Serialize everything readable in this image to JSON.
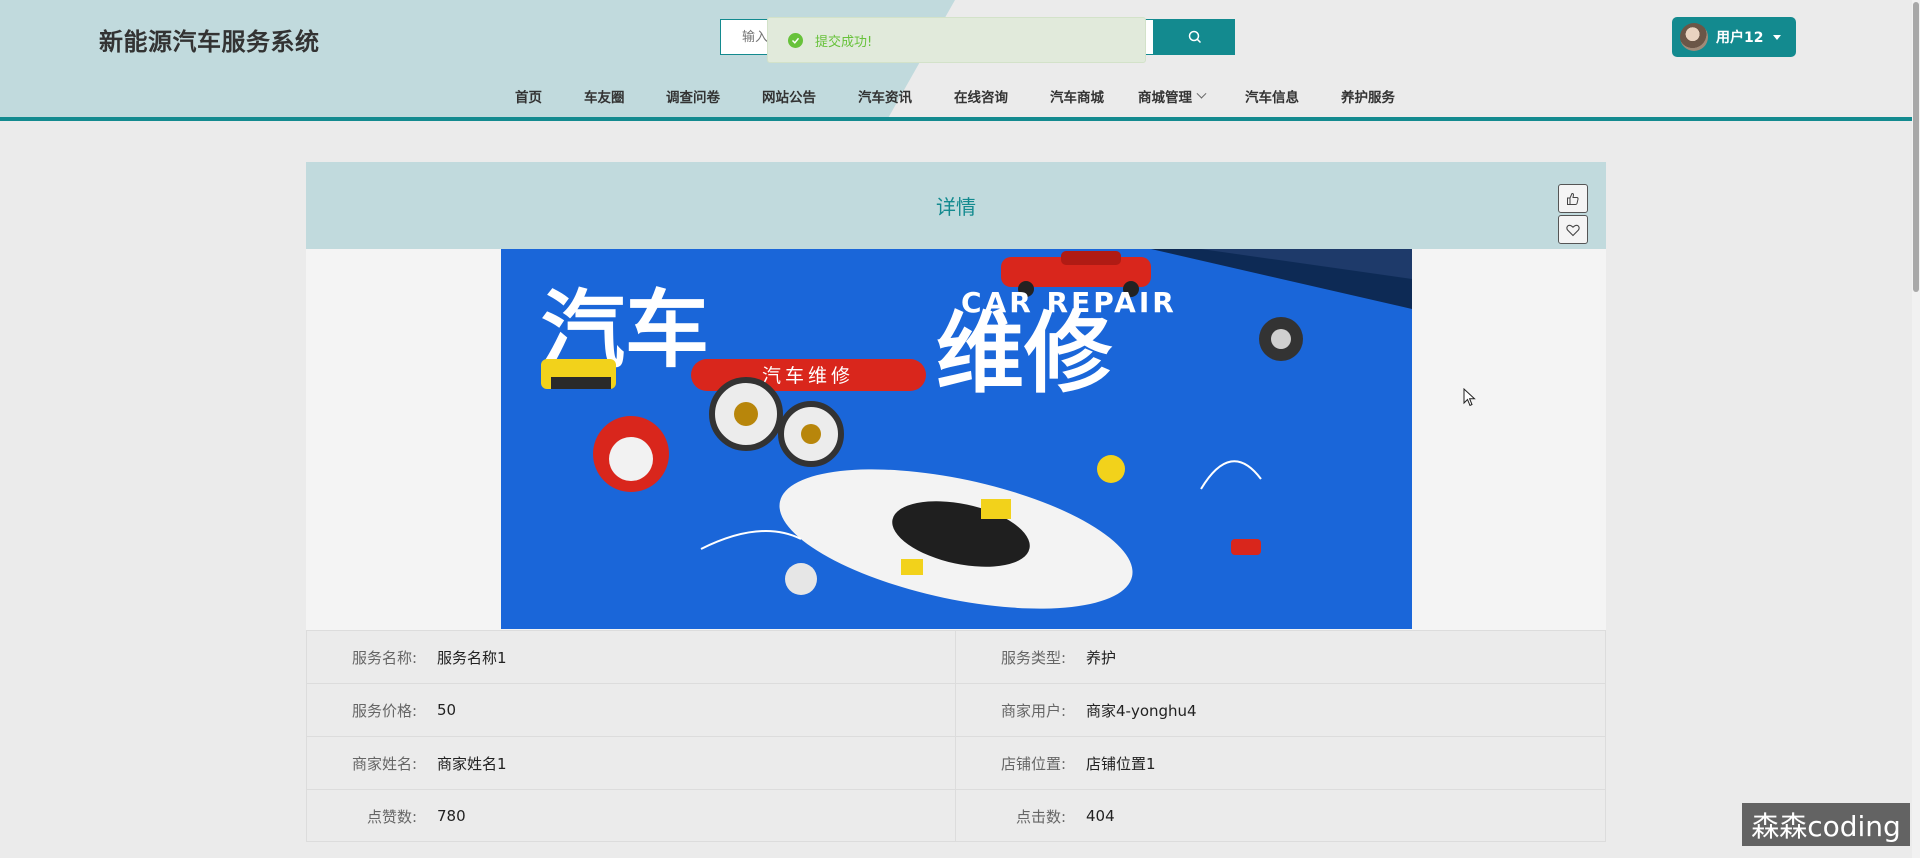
{
  "header": {
    "site_title": "新能源汽车服务系统",
    "search_placeholder": "输入",
    "user_name": "用户12",
    "accent_color": "#138a8f",
    "header_bg_color": "#c1dadd"
  },
  "toast": {
    "message": "提交成功!",
    "icon": "check-circle-icon",
    "color": "#67c23a"
  },
  "nav": {
    "items": [
      "首页",
      "车友圈",
      "调查问卷",
      "网站公告",
      "汽车资讯",
      "在线咨询",
      "汽车商城",
      "商城管理",
      "汽车信息",
      "养护服务"
    ]
  },
  "detail": {
    "title": "详情",
    "like_icon": "thumbs-up-icon",
    "favorite_icon": "heart-icon",
    "banner": {
      "title_cn": "汽车维修",
      "title_en": "CAR REPAIR",
      "tag": "汽车维修"
    },
    "fields": [
      {
        "label": "服务名称:",
        "value": "服务名称1"
      },
      {
        "label": "服务类型:",
        "value": "养护"
      },
      {
        "label": "服务价格:",
        "value": "50"
      },
      {
        "label": "商家用户:",
        "value": "商家4-yonghu4"
      },
      {
        "label": "商家姓名:",
        "value": "商家姓名1"
      },
      {
        "label": "店铺位置:",
        "value": "店铺位置1"
      },
      {
        "label": "点赞数:",
        "value": "780"
      },
      {
        "label": "点击数:",
        "value": "404"
      }
    ]
  },
  "watermark": "森森coding"
}
